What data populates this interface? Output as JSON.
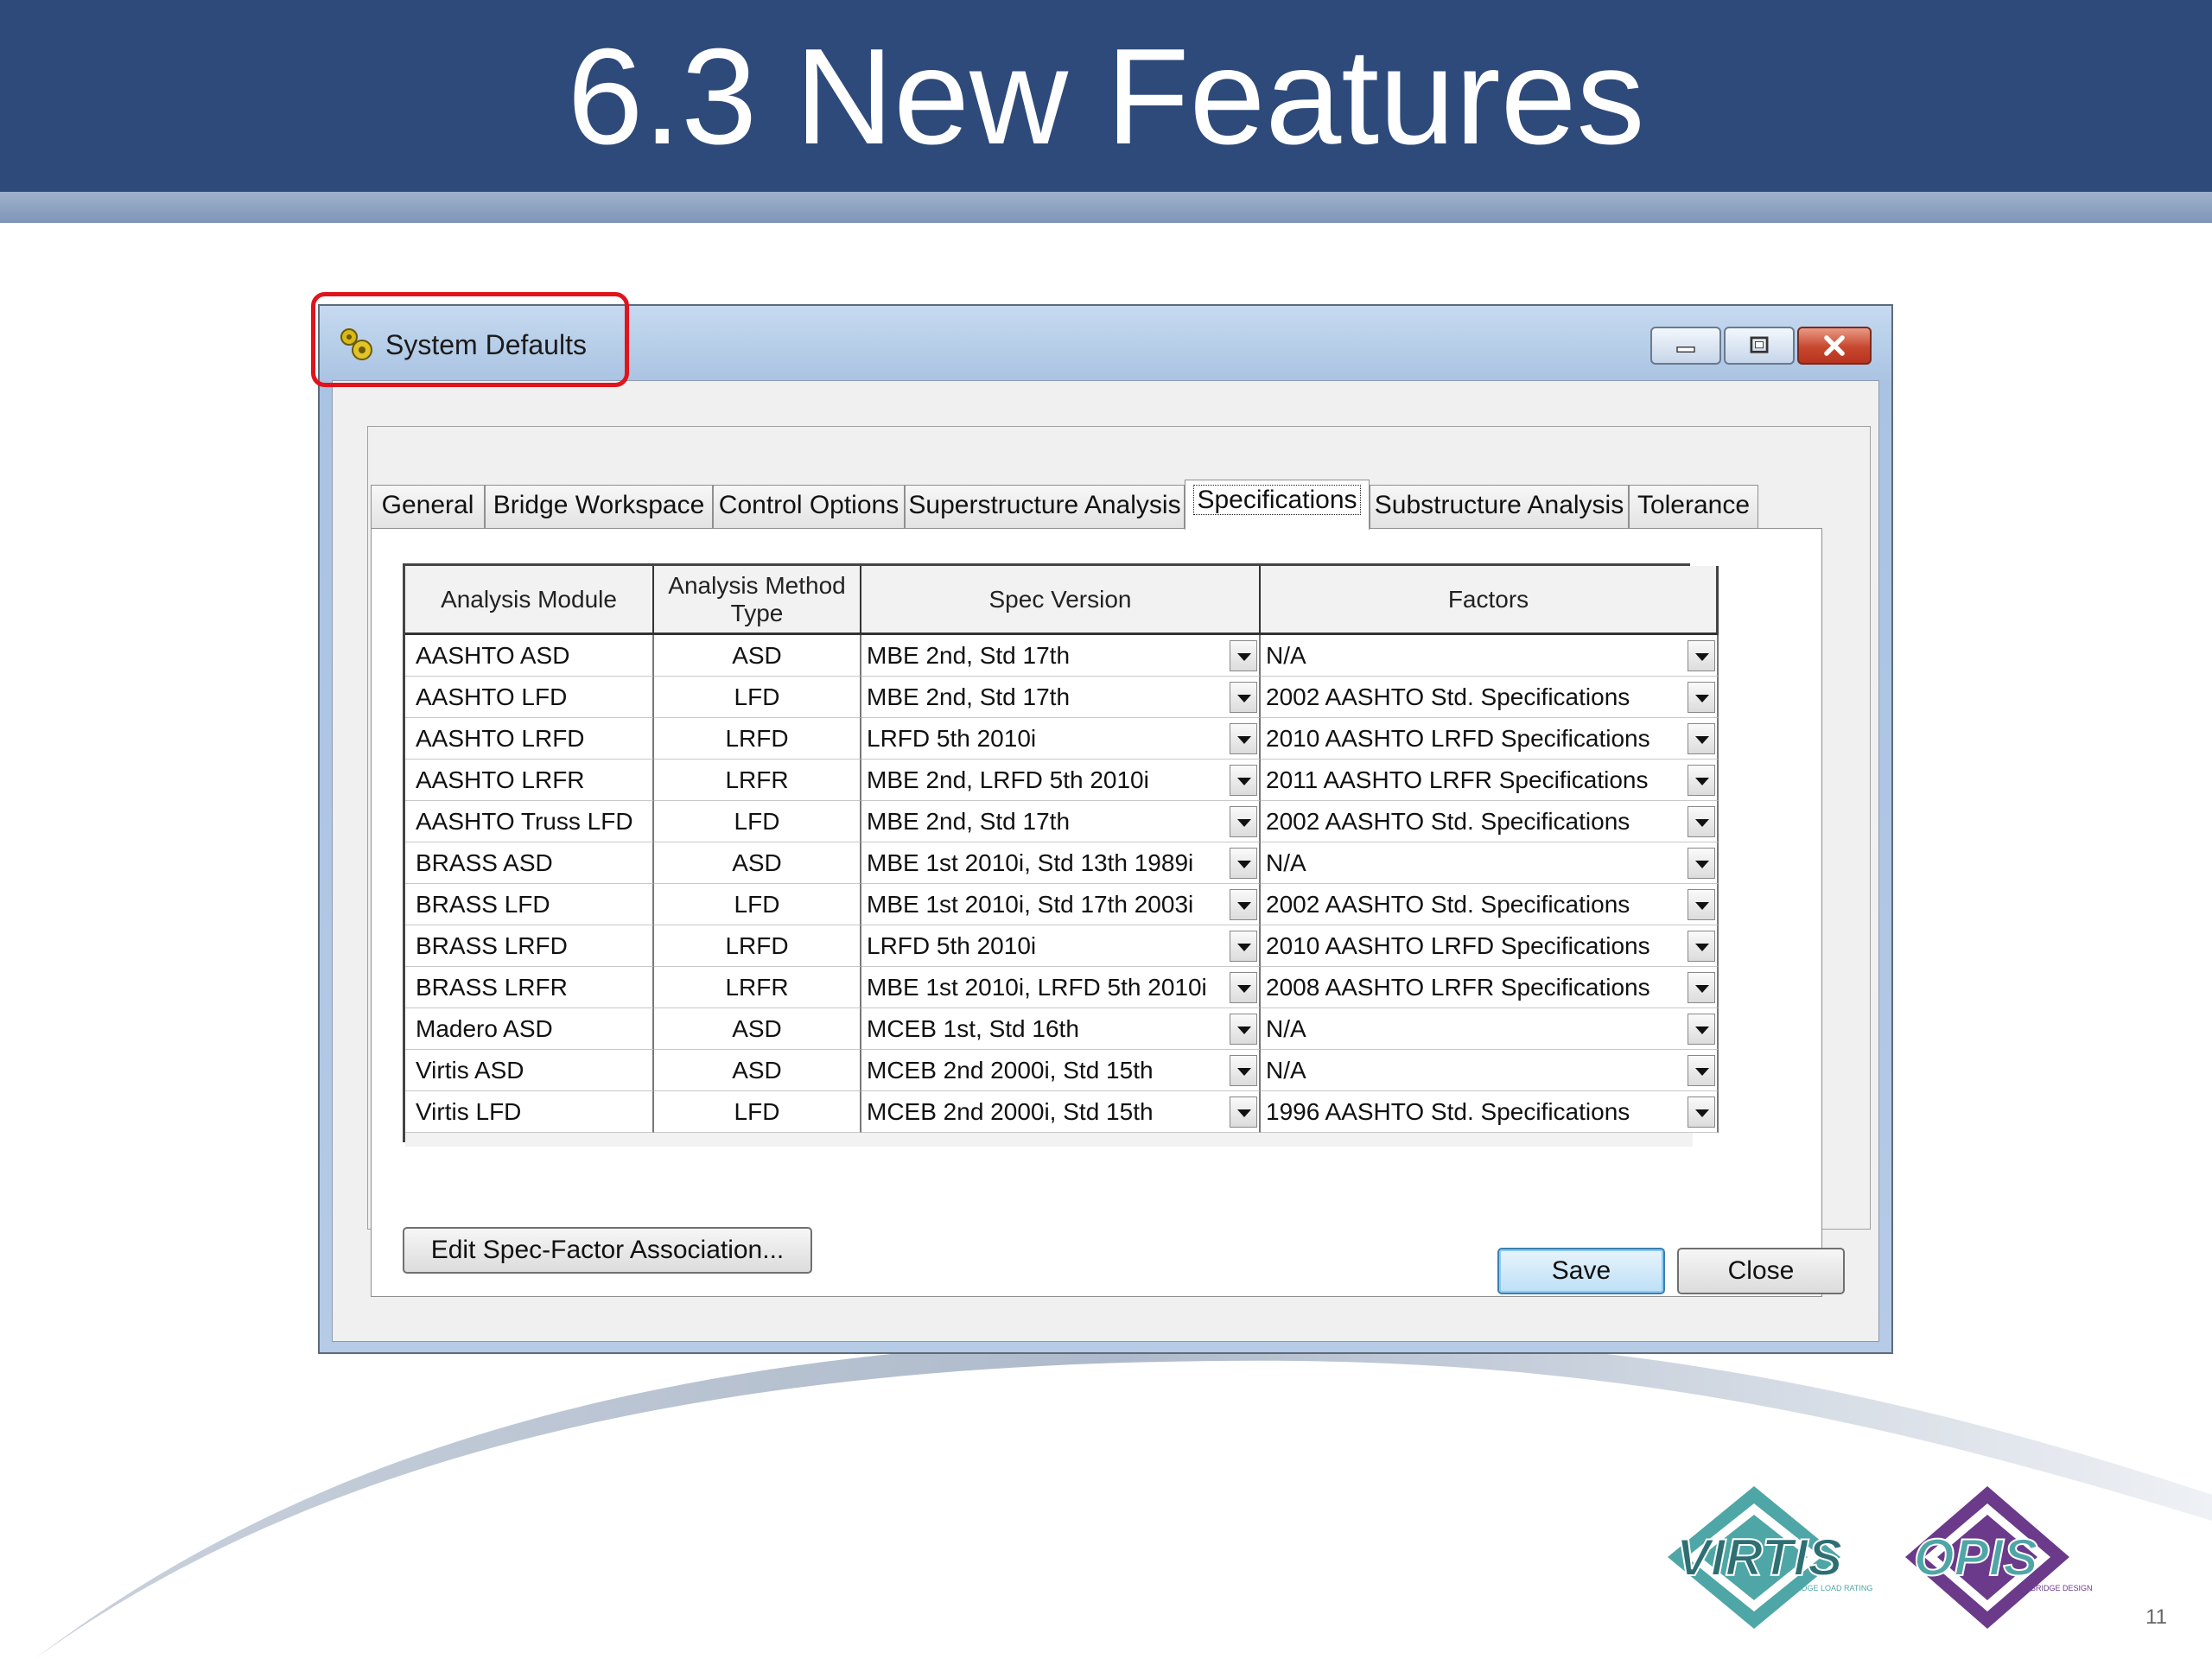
{
  "slide": {
    "title": "6.3 New Features",
    "page_number": "11"
  },
  "window": {
    "title": "System Defaults",
    "icon": "gears-icon"
  },
  "tabs": [
    {
      "label": "General"
    },
    {
      "label": "Bridge Workspace"
    },
    {
      "label": "Control Options"
    },
    {
      "label": "Superstructure Analysis"
    },
    {
      "label": "Specifications",
      "active": true
    },
    {
      "label": "Substructure Analysis"
    },
    {
      "label": "Tolerance"
    }
  ],
  "grid": {
    "headers": [
      "Analysis Module",
      "Analysis Method Type",
      "Spec Version",
      "Factors"
    ],
    "header_type_line1": "Analysis Method",
    "header_type_line2": "Type",
    "rows": [
      {
        "module": "AASHTO ASD",
        "type": "ASD",
        "spec": "MBE 2nd, Std 17th",
        "factors": "N/A"
      },
      {
        "module": "AASHTO LFD",
        "type": "LFD",
        "spec": "MBE 2nd, Std 17th",
        "factors": "2002 AASHTO Std. Specifications"
      },
      {
        "module": "AASHTO LRFD",
        "type": "LRFD",
        "spec": "LRFD 5th 2010i",
        "factors": "2010 AASHTO LRFD Specifications"
      },
      {
        "module": "AASHTO LRFR",
        "type": "LRFR",
        "spec": "MBE 2nd, LRFD 5th 2010i",
        "factors": "2011 AASHTO LRFR Specifications"
      },
      {
        "module": "AASHTO Truss LFD",
        "type": "LFD",
        "spec": "MBE 2nd, Std 17th",
        "factors": "2002 AASHTO Std. Specifications"
      },
      {
        "module": "BRASS ASD",
        "type": "ASD",
        "spec": "MBE 1st 2010i, Std 13th 1989i",
        "factors": "N/A"
      },
      {
        "module": "BRASS LFD",
        "type": "LFD",
        "spec": "MBE 1st 2010i, Std 17th 2003i",
        "factors": "2002 AASHTO Std. Specifications"
      },
      {
        "module": "BRASS LRFD",
        "type": "LRFD",
        "spec": "LRFD 5th 2010i",
        "factors": "2010 AASHTO LRFD Specifications"
      },
      {
        "module": "BRASS LRFR",
        "type": "LRFR",
        "spec": "MBE 1st 2010i, LRFD 5th 2010i",
        "factors": "2008 AASHTO LRFR Specifications"
      },
      {
        "module": "Madero ASD",
        "type": "ASD",
        "spec": "MCEB 1st, Std 16th",
        "factors": "N/A"
      },
      {
        "module": "Virtis ASD",
        "type": "ASD",
        "spec": "MCEB 2nd 2000i, Std 15th",
        "factors": "N/A"
      },
      {
        "module": "Virtis LFD",
        "type": "LFD",
        "spec": "MCEB 2nd 2000i, Std 15th",
        "factors": "1996 AASHTO Std. Specifications"
      }
    ]
  },
  "buttons": {
    "edit_association": "Edit Spec-Factor Association...",
    "save": "Save",
    "close": "Close"
  },
  "logos": {
    "virtis": {
      "text": "VIRTIS",
      "subtext": "BRIDGE LOAD RATING",
      "color": "#4fa6a6"
    },
    "opis": {
      "text": "OPIS",
      "subtext": "BRIDGE DESIGN",
      "color": "#6b3a8a"
    }
  },
  "colors": {
    "title_bar": "#2e4a7a",
    "highlight": "#e0141c"
  }
}
